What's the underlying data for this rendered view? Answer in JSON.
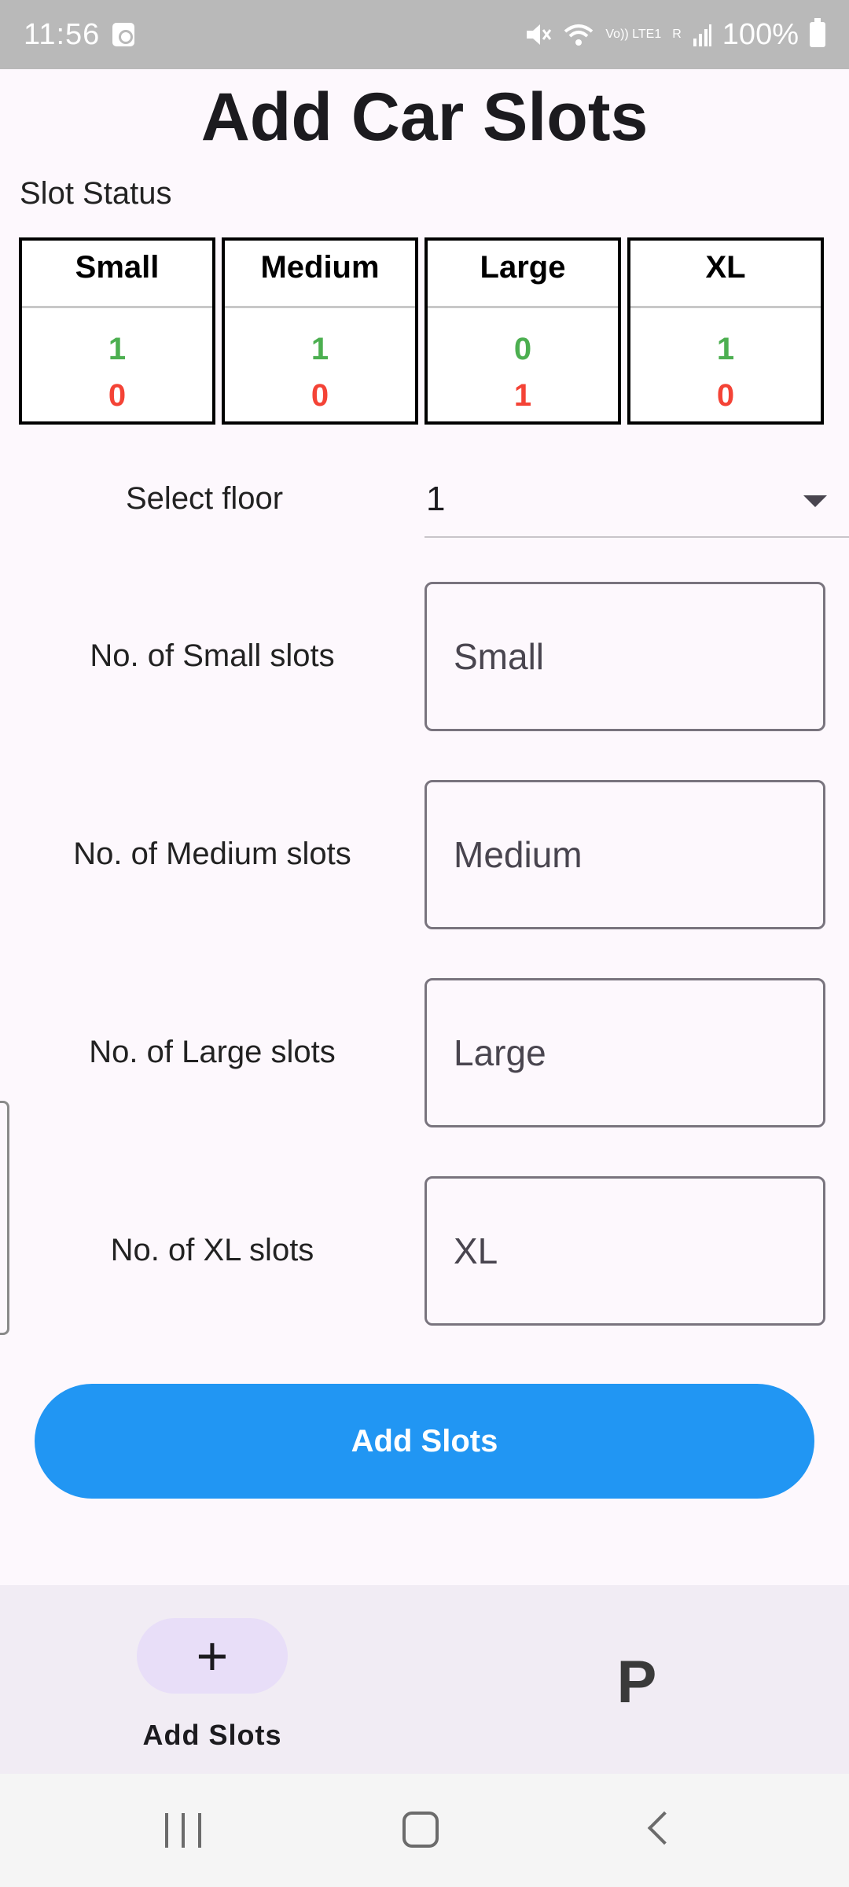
{
  "status_bar": {
    "time": "11:56",
    "network": "Vo)) LTE1",
    "signal": "R",
    "battery": "100%"
  },
  "header": {
    "title": "Add Car Slots"
  },
  "slot_status": {
    "label": "Slot Status",
    "cards": [
      {
        "name": "Small",
        "available": "1",
        "occupied": "0"
      },
      {
        "name": "Medium",
        "available": "1",
        "occupied": "0"
      },
      {
        "name": "Large",
        "available": "0",
        "occupied": "1"
      },
      {
        "name": "XL",
        "available": "1",
        "occupied": "0"
      }
    ],
    "colors": {
      "available": "#4caf50",
      "occupied": "#f44336"
    }
  },
  "floor": {
    "label": "Select floor",
    "selected": "1"
  },
  "form": {
    "small": {
      "label": "No. of Small slots",
      "placeholder": "Small"
    },
    "medium": {
      "label": "No. of Medium slots",
      "placeholder": "Medium"
    },
    "large": {
      "label": "No. of Large slots",
      "placeholder": "Large"
    },
    "xl": {
      "label": "No. of XL slots",
      "placeholder": "XL"
    }
  },
  "action": {
    "label": "Add Slots",
    "color": "#2196f3"
  },
  "bottom_nav": {
    "items": [
      {
        "label": "Add Slots",
        "icon": "plus-icon",
        "active": true
      },
      {
        "label": "",
        "icon": "P",
        "active": false
      }
    ]
  },
  "system_nav": {
    "recents": "recents-icon",
    "home": "home-icon",
    "back": "back-icon"
  }
}
